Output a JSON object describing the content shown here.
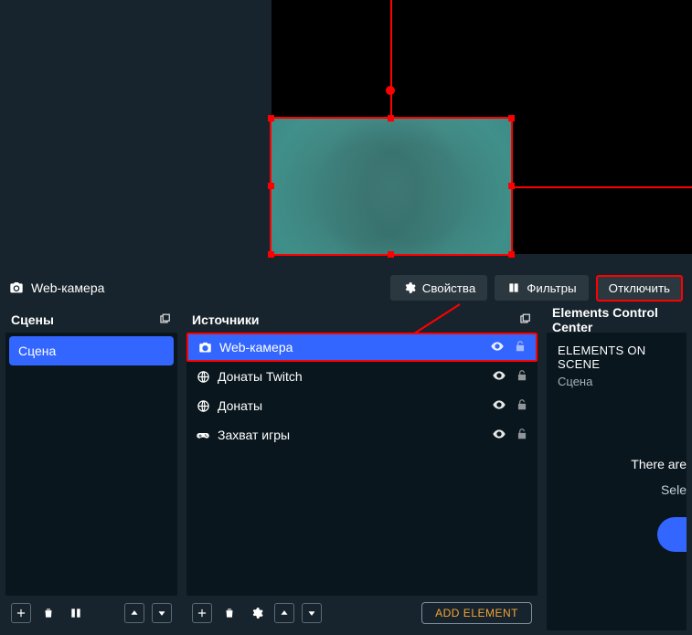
{
  "toolbar": {
    "active_source": "Web-камера",
    "properties": "Свойства",
    "filters": "Фильтры",
    "disable": "Отключить"
  },
  "scenes": {
    "header": "Сцены",
    "items": [
      {
        "label": "Сцена",
        "selected": true
      }
    ]
  },
  "sources": {
    "header": "Источники",
    "items": [
      {
        "icon": "camera",
        "label": "Web-камера",
        "visible": true,
        "locked": true,
        "selected": true
      },
      {
        "icon": "world",
        "label": "Донаты Twitch",
        "visible": true,
        "locked": true,
        "selected": false
      },
      {
        "icon": "world",
        "label": "Донаты",
        "visible": true,
        "locked": true,
        "selected": false
      },
      {
        "icon": "gamepad",
        "label": "Захват игры",
        "visible": true,
        "locked": true,
        "selected": false
      }
    ],
    "add_element": "ADD ELEMENT"
  },
  "elements_panel": {
    "header": "Elements Control Center",
    "on_scene": "ELEMENTS ON SCENE",
    "scene_name": "Сцена",
    "empty_title": "There are",
    "empty_sub": "Sele"
  }
}
